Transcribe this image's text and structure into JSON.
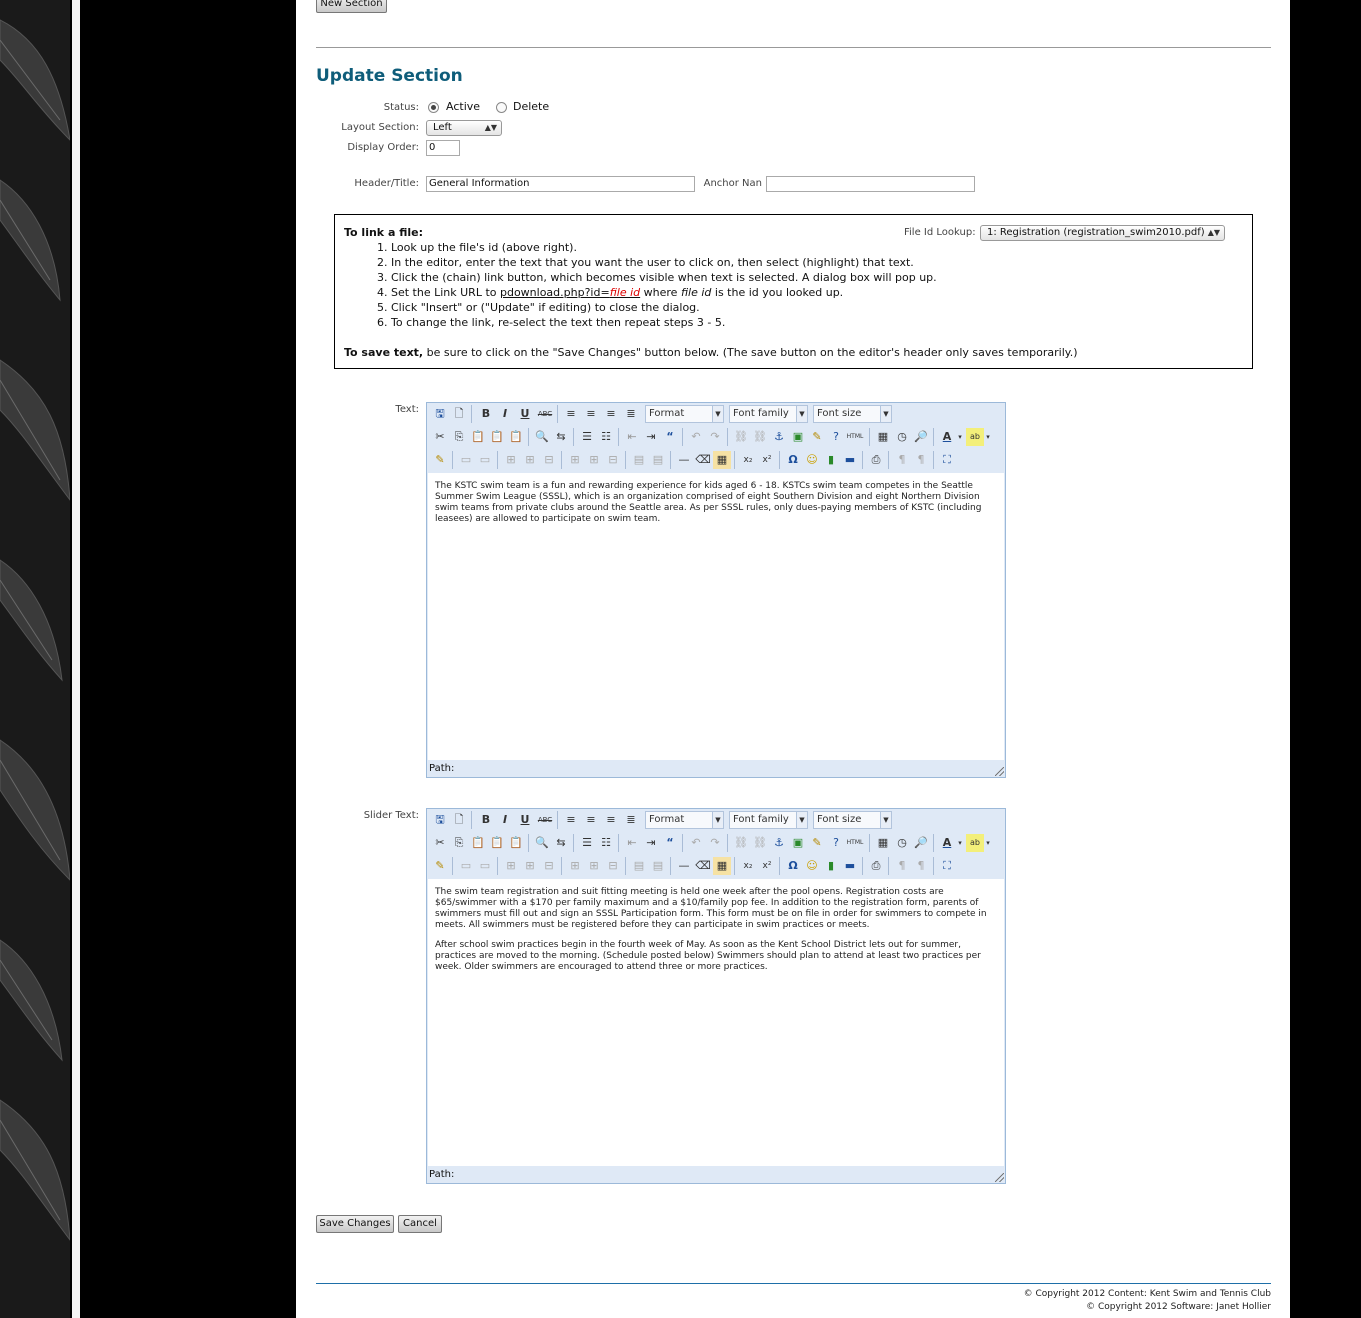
{
  "buttons": {
    "new_section": "New Section",
    "save_changes": "Save Changes",
    "cancel": "Cancel"
  },
  "section_title": "Update Section",
  "form": {
    "status_label": "Status:",
    "status_options": [
      "Active",
      "Delete"
    ],
    "status_selected": "Active",
    "layout_label": "Layout Section:",
    "layout_value": "Left",
    "display_order_label": "Display Order:",
    "display_order_value": "0",
    "header_title_label": "Header/Title:",
    "header_title_value": "General Information",
    "anchor_name_label": "Anchor Nan",
    "anchor_name_value": ""
  },
  "info": {
    "heading": "To link a file:",
    "file_lookup_label": "File Id Lookup:",
    "file_lookup_value": "1: Registration (registration_swim2010.pdf)",
    "steps": [
      "1. Look up the file's id (above right).",
      "2. In the editor, enter the text that you want the user to click on, then select (highlight) that text.",
      "3. Click the (chain) link button, which becomes visible when text is selected. A dialog box will pop up.",
      "4. Set the Link URL to ",
      "5. Click \"Insert\" or (\"Update\" if editing) to close the dialog.",
      "6. To change the link, re-select the text then repeat steps 3 - 5."
    ],
    "step4_link": "pdownload.php?id=",
    "step4_fileid": "file id",
    "step4_where": " where ",
    "step4_fileid2": "file id",
    "step4_rest": " is the id you looked up.",
    "save_bold": "To save text,",
    "save_rest": " be sure to click on the \"Save Changes\" button below. (The save button on the editor's header only saves temporarily.)"
  },
  "editor_toolbar": {
    "format": "Format",
    "font_family": "Font family",
    "font_size": "Font size"
  },
  "text_editor": {
    "label": "Text:",
    "path_label": "Path:",
    "paragraphs": [
      "The KSTC swim team is a fun and rewarding experience for kids aged 6 - 18. KSTCs swim team competes in the Seattle Summer Swim League (SSSL), which is an organization comprised of eight Southern Division and eight Northern Division swim teams from private clubs around the Seattle area. As per SSSL rules, only dues-paying members of KSTC (including leasees) are allowed to participate on swim team."
    ]
  },
  "slider_editor": {
    "label": "Slider Text:",
    "path_label": "Path:",
    "paragraphs": [
      "The swim team registration and suit fitting meeting is held one week after the pool opens. Registration costs are $65/swimmer with a $170 per family maximum and a $10/family pop fee. In addition to the registration form, parents of swimmers must fill out and sign an SSSL Participation form. This form must be on file in order for swimmers to compete in meets. All swimmers must be registered before they can participate in swim practices or meets.",
      "After school swim practices begin in the fourth week of May. As soon as the Kent School District lets out for summer, practices are moved to the morning. (Schedule posted below) Swimmers should plan to attend at least two practices per week. Older swimmers are encouraged to attend three or more practices."
    ]
  },
  "footer": {
    "copyright_content": "© Copyright 2012 Content: Kent Swim and Tennis Club",
    "copyright_software": "© Copyright 2012 Software: Janet Hollier"
  },
  "colors": {
    "title": "#0f5d7a",
    "editor_toolbar": "#dfe9f6",
    "footer_rule": "#1e6fa8"
  }
}
